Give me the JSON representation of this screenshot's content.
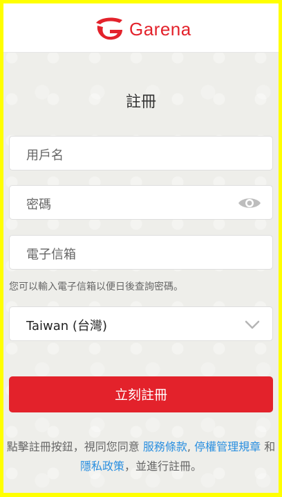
{
  "header": {
    "brand": "Garena"
  },
  "page": {
    "title": "註冊"
  },
  "form": {
    "username_placeholder": "用戶名",
    "password_placeholder": "密碼",
    "email_placeholder": "電子信箱",
    "email_hint": "您可以輸入電子信箱以便日後查詢密碼。",
    "country_value": "Taiwan (台灣)",
    "submit_label": "立刻註冊"
  },
  "terms": {
    "prefix": "點擊註冊按鈕，視同您同意",
    "service_terms": "服務條款",
    "sep1": ",",
    "suspension_rules": "停權管理規章",
    "and": "和",
    "privacy_policy": "隱私政策",
    "suffix": "，並進行註冊。"
  },
  "colors": {
    "brand_red": "#e3222b",
    "link_blue": "#2a8fe0",
    "frame_yellow": "#ffff00"
  }
}
